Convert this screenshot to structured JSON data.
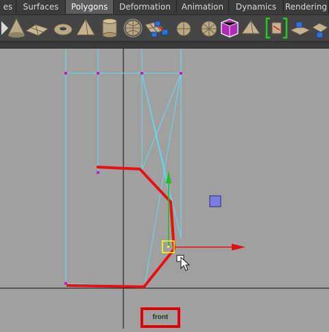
{
  "tabs": [
    {
      "label": "es",
      "active": false
    },
    {
      "label": "Surfaces",
      "active": false
    },
    {
      "label": "Polygons",
      "active": true
    },
    {
      "label": "Deformation",
      "active": false
    },
    {
      "label": "Animation",
      "active": false
    },
    {
      "label": "Dynamics",
      "active": false
    },
    {
      "label": "Rendering",
      "active": false
    }
  ],
  "shelf": {
    "icons": [
      "shelf-arrow-icon",
      "cone-icon",
      "plane-icon",
      "torus-icon",
      "pyramid-icon",
      "cylinder-icon",
      "sphere-icon",
      "grid-plane-icon",
      "combine-icon",
      "separate-icon",
      "poly-sphere-icon",
      "poly-sphere-alt-icon",
      "bevel-icon",
      "smooth-proxy-icon",
      "pyramid-alt-icon",
      "split-polygon-icon",
      "extrude-face-icon",
      "extrude-edge-icon",
      "merge-icon"
    ]
  },
  "viewport": {
    "camera_label": "front",
    "colors": {
      "background": "#a0a0a0",
      "wireframe": "#5fdcf2",
      "selection": "#e81010",
      "vertex": "#c020c0",
      "y_handle": "#1fbf1f",
      "x_handle": "#e01010",
      "pivot": "#ffff00",
      "locator": "#7b7be0"
    }
  }
}
